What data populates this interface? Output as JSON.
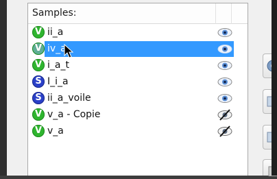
{
  "panel": {
    "title": "Samples:"
  },
  "samples": [
    {
      "label": "ii_a",
      "badge": "V",
      "badge_type": "v",
      "visible": true,
      "selected": false
    },
    {
      "label": "iv_a",
      "badge": "V",
      "badge_type": "v",
      "visible": true,
      "selected": true
    },
    {
      "label": "i_a_t",
      "badge": "V",
      "badge_type": "v",
      "visible": true,
      "selected": false
    },
    {
      "label": "I_i_a",
      "badge": "S",
      "badge_type": "s",
      "visible": true,
      "selected": false
    },
    {
      "label": "ii_a_voile",
      "badge": "S",
      "badge_type": "s",
      "visible": true,
      "selected": false
    },
    {
      "label": "v_a - Copie",
      "badge": "V",
      "badge_type": "v",
      "visible": false,
      "selected": false
    },
    {
      "label": "v_a",
      "badge": "V",
      "badge_type": "v",
      "visible": false,
      "selected": false
    }
  ],
  "colors": {
    "selection": "#3399ff",
    "badge_v": "#2fb52f",
    "badge_s": "#2a40c8"
  },
  "toolbar_icons": [
    "settings-gear-icon",
    "add-tool-icon",
    "remove-tool-icon",
    "more-tool-icon"
  ]
}
